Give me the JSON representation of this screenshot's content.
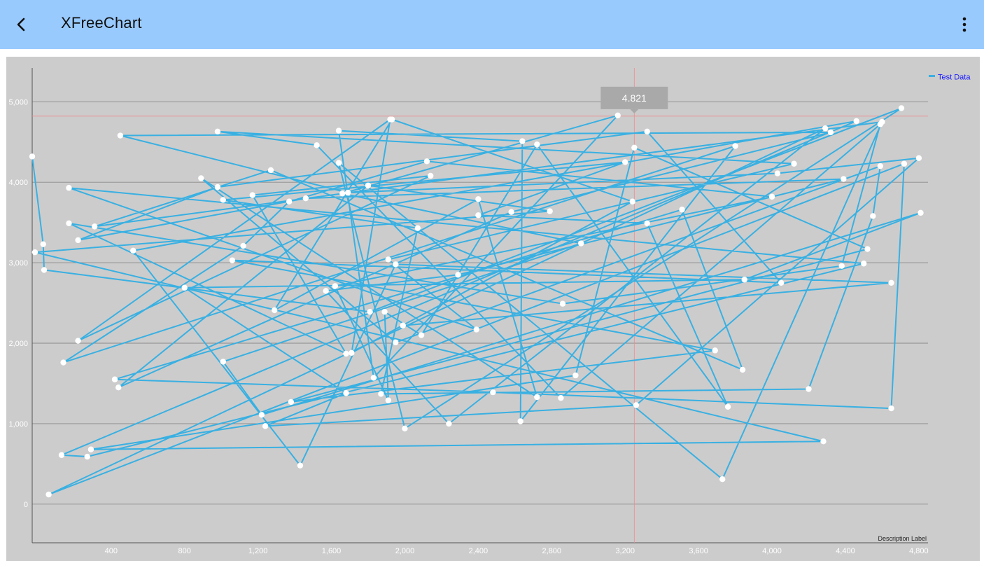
{
  "app_bar": {
    "title": "XFreeChart",
    "back_icon": "arrow-back-icon",
    "menu_icon": "more-vert-icon",
    "background": "#99cafe"
  },
  "chart_data": {
    "type": "line",
    "xlabel": "Description Label",
    "ylabel": "",
    "x_ticks": [
      "400",
      "800",
      "1,200",
      "1,600",
      "2,000",
      "2,400",
      "2,800",
      "3,200",
      "3,600",
      "4,000",
      "4,400",
      "4,800"
    ],
    "x_tick_values": [
      400,
      800,
      1200,
      1600,
      2000,
      2400,
      2800,
      3200,
      3600,
      4000,
      4400,
      4800
    ],
    "y_ticks": [
      "0",
      "1,000",
      "2,000",
      "3,000",
      "4,000",
      "5,000"
    ],
    "y_tick_values": [
      0,
      1000,
      2000,
      3000,
      4000,
      5000
    ],
    "xlim": [
      -30,
      4850
    ],
    "ylim": [
      -480,
      5420
    ],
    "grid": "horizontal",
    "legend_position": "top-right",
    "series": [
      {
        "name": "Test Data",
        "color": "#39b0e2",
        "x": [
          -30,
          30,
          35,
          1810,
          4705,
          2000,
          1640,
          3730,
          4600,
          310,
          1270,
          3840,
          3510,
          420,
          2480,
          4650,
          4720,
          60,
          4290,
          2240,
          1570,
          2290,
          4390,
          1460,
          220,
          980,
          3320,
          4050,
          1060,
          3690,
          1380,
          4520,
          3250,
          2930,
          290,
          4280,
          -15,
          2790,
          1800,
          440,
          2580,
          4320,
          450,
          1690,
          4030,
          4800,
          3260,
          1240,
          1680,
          800,
          3850,
          4810,
          1220,
          1010,
          2960,
          1660,
          3160,
          1830,
          1640,
          2640,
          2630,
          3800,
          140,
          1120,
          1370,
          2120,
          4000,
          1620,
          1910,
          1890,
          2090,
          2720,
          3760,
          3320,
          2400,
          3200,
          1010,
          2070,
          1870,
          4200,
          4550,
          4590,
          1950,
          890,
          2720,
          2400,
          1290,
          1930,
          3240,
          1710,
          1920,
          220,
          2140,
          1170,
          1680,
          170,
          2860,
          4380,
          4590,
          2850,
          1520,
          980,
          4120,
          1910,
          2390,
          170,
          4500,
          270,
          130,
          4460,
          520,
          1430,
          1950,
          4650,
          1990
        ],
        "y": [
          4320,
          3230,
          2910,
          2390,
          4920,
          940,
          4240,
          310,
          4750,
          3450,
          4150,
          1670,
          3660,
          1550,
          1390,
          1190,
          4230,
          120,
          4670,
          1000,
          2650,
          2850,
          4040,
          3800,
          3280,
          3940,
          4630,
          2750,
          3030,
          1910,
          1270,
          3170,
          4430,
          1600,
          680,
          780,
          3130,
          3640,
          3960,
          1450,
          3630,
          4620,
          4580,
          3870,
          4110,
          4300,
          1230,
          970,
          1380,
          2690,
          2790,
          3620,
          1110,
          1770,
          3240,
          3860,
          4830,
          1570,
          4640,
          4510,
          1030,
          4450,
          1760,
          3210,
          3760,
          4260,
          3820,
          2710,
          1290,
          2390,
          2100,
          4470,
          1210,
          3490,
          3590,
          4250,
          3780,
          3430,
          1370,
          1430,
          3580,
          4200,
          2010,
          4050,
          1330,
          3790,
          2410,
          4780,
          3760,
          1880,
          4780,
          2030,
          4080,
          3840,
          1870,
          3490,
          2490,
          2960,
          4720,
          1320,
          4460,
          4630,
          4230,
          3040,
          2170,
          3930,
          2990,
          590,
          610,
          4760,
          3150,
          480,
          2980,
          2750,
          2220
        ],
        "last_point_label": "4.821"
      }
    ],
    "highlight": {
      "x": 3250,
      "y": 4821,
      "label": "4.821"
    }
  }
}
